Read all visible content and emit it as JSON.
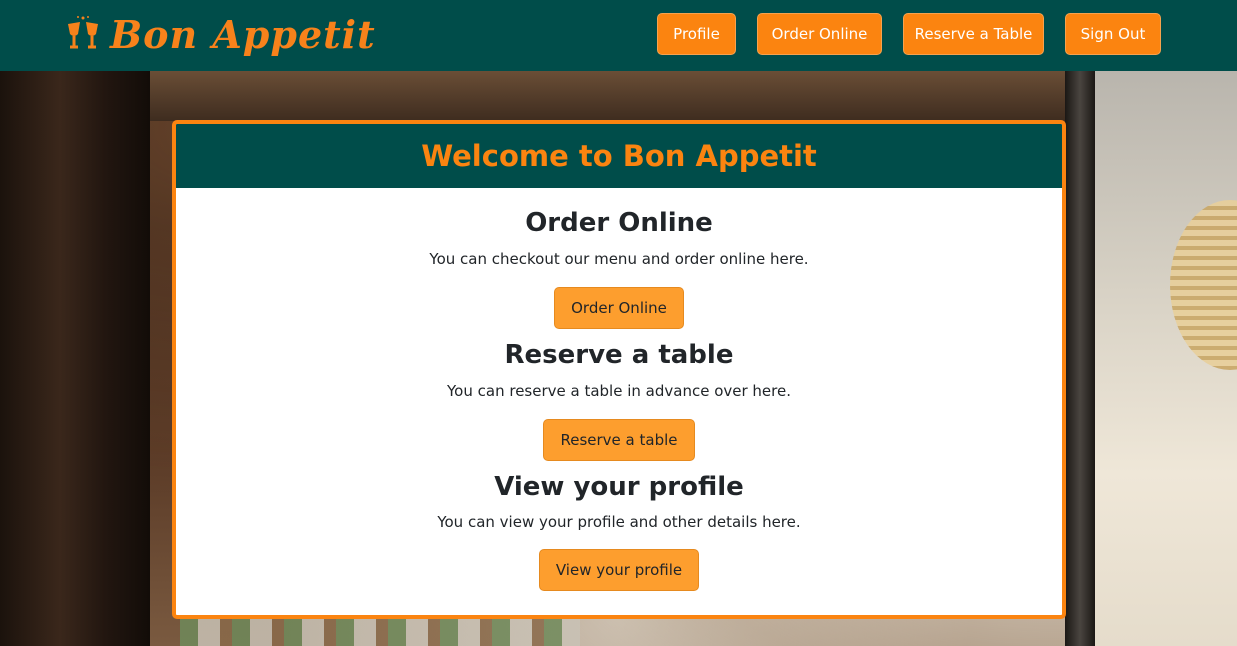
{
  "brand": {
    "name": "Bon Appetit",
    "icon": "cheers-glasses-icon",
    "color": "#f7821b"
  },
  "nav": {
    "profile": "Profile",
    "order_online": "Order Online",
    "reserve_table": "Reserve a Table",
    "sign_out": "Sign Out"
  },
  "card": {
    "title": "Welcome to Bon Appetit",
    "sections": [
      {
        "heading": "Order Online",
        "description": "You can checkout our menu and order online here.",
        "button": "Order Online"
      },
      {
        "heading": "Reserve a table",
        "description": "You can reserve a table in advance over here.",
        "button": "Reserve a table"
      },
      {
        "heading": "View your profile",
        "description": "You can view your profile and other details here.",
        "button": "View your profile"
      }
    ]
  },
  "colors": {
    "primary_dark": "#004d4a",
    "accent": "#fb8410",
    "button_light": "#fd9e2e"
  }
}
